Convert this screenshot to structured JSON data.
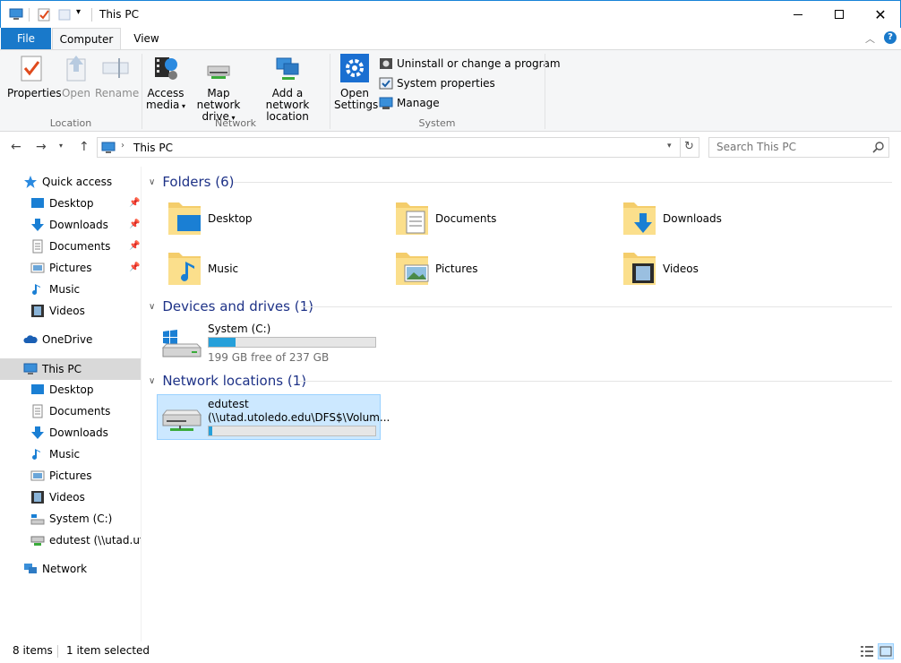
{
  "window": {
    "title": "This PC"
  },
  "ribbon_tabs": {
    "file": "File",
    "computer": "Computer",
    "view": "View"
  },
  "ribbon": {
    "location": {
      "properties": "Properties",
      "open": "Open",
      "rename": "Rename",
      "group_label": "Location"
    },
    "network": {
      "access_media_l1": "Access",
      "access_media_l2": "media",
      "map_drive_l1": "Map network",
      "map_drive_l2": "drive",
      "add_location_l1": "Add a network",
      "add_location_l2": "location",
      "group_label": "Network"
    },
    "system": {
      "open_settings_l1": "Open",
      "open_settings_l2": "Settings",
      "uninstall": "Uninstall or change a program",
      "system_properties": "System properties",
      "manage": "Manage",
      "group_label": "System"
    }
  },
  "address": {
    "path": "This PC"
  },
  "search": {
    "placeholder": "Search This PC"
  },
  "sidebar": {
    "quick_access": "Quick access",
    "qa_items": [
      "Desktop",
      "Downloads",
      "Documents",
      "Pictures",
      "Music",
      "Videos"
    ],
    "onedrive": "OneDrive",
    "this_pc": "This PC",
    "pc_items": [
      "Desktop",
      "Documents",
      "Downloads",
      "Music",
      "Pictures",
      "Videos",
      "System (C:)",
      "edutest (\\\\utad.utol"
    ],
    "network": "Network"
  },
  "content": {
    "folders_header": "Folders (6)",
    "folders": [
      "Desktop",
      "Documents",
      "Downloads",
      "Music",
      "Pictures",
      "Videos"
    ],
    "devices_header": "Devices and drives (1)",
    "drive_c": {
      "name": "System (C:)",
      "free_text": "199 GB free of 237 GB",
      "used_fraction": 0.16
    },
    "network_header": "Network locations (1)",
    "network_drive": {
      "name": "edutest",
      "path": "(\\\\utad.utoledo.edu\\DFS$\\Volum...",
      "used_fraction": 0.02
    }
  },
  "statusbar": {
    "items": "8 items",
    "selected": "1 item selected"
  },
  "colors": {
    "accent": "#1979ca",
    "group_header": "#1e3287",
    "selection": "#cce8ff",
    "drive_fill": "#26a0da"
  }
}
